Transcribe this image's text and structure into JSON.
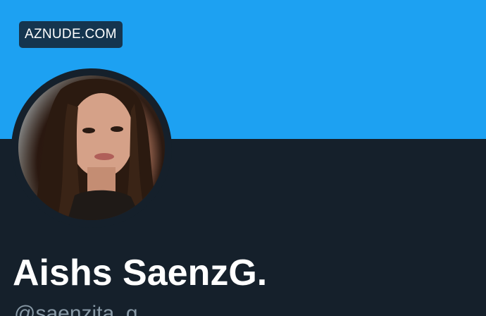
{
  "watermark": {
    "text": "AZNUDE.COM"
  },
  "profile": {
    "display_name": "Aishs SaenzG.",
    "handle": "@saenzita_g",
    "avatar_icon": "profile-photo"
  },
  "colors": {
    "banner": "#1da1f2",
    "background": "#15202b",
    "name_text": "#ffffff",
    "handle_text": "#8899a6",
    "watermark_bg": "#15354f"
  }
}
